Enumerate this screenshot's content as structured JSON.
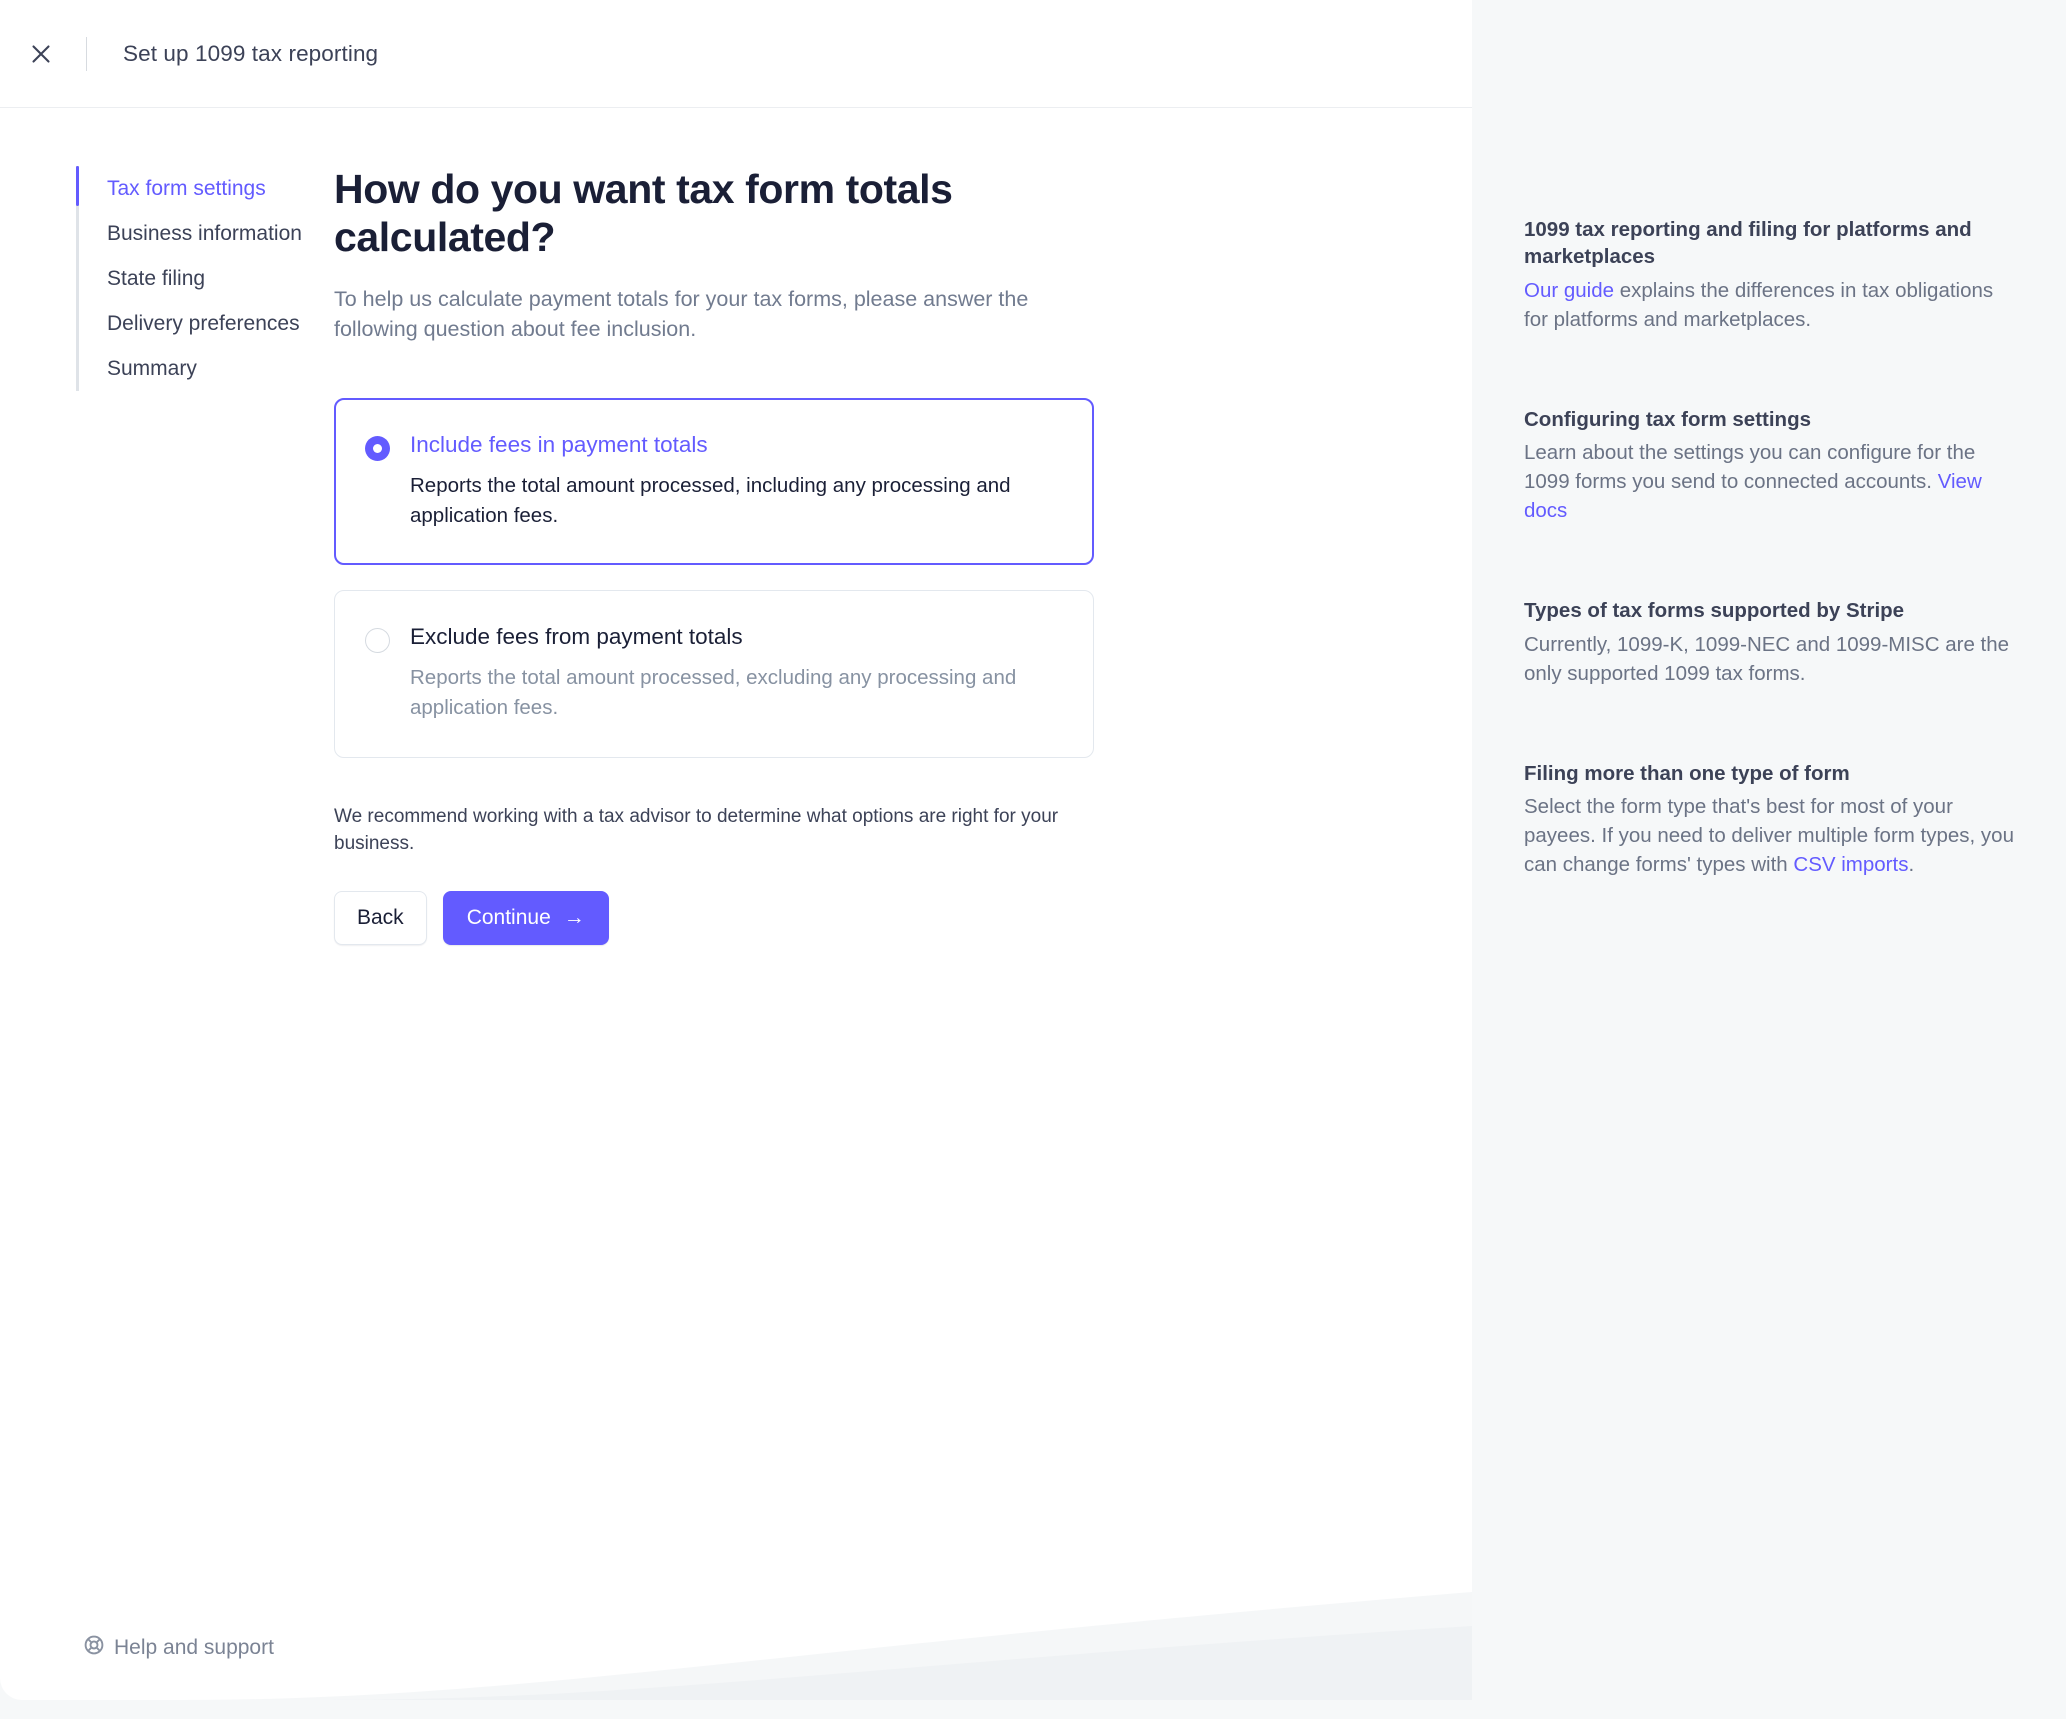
{
  "header": {
    "close_icon": "close-icon",
    "title": "Set up 1099 tax reporting"
  },
  "sidebar": {
    "steps": [
      {
        "label": "Tax form settings",
        "active": true
      },
      {
        "label": "Business information",
        "active": false
      },
      {
        "label": "State filing",
        "active": false
      },
      {
        "label": "Delivery preferences",
        "active": false
      },
      {
        "label": "Summary",
        "active": false
      }
    ]
  },
  "main": {
    "title": "How do you want tax form totals calculated?",
    "subtitle": "To help us calculate payment totals for your tax forms, please answer the following question about fee inclusion.",
    "options": [
      {
        "label": "Include fees in payment totals",
        "description": "Reports the total amount processed, including any processing and application fees.",
        "selected": true
      },
      {
        "label": "Exclude fees from payment totals",
        "description": "Reports the total amount processed, excluding any processing and application fees.",
        "selected": false
      }
    ],
    "note": "We recommend working with a tax advisor to determine what options are right for your business.",
    "back_label": "Back",
    "continue_label": "Continue",
    "continue_arrow": "→"
  },
  "footer": {
    "help_icon": "life-ring-icon",
    "help_label": "Help and support"
  },
  "help_rail": {
    "sections": [
      {
        "heading": "1099 tax reporting and filing for platforms and marketplaces",
        "link_before": "Our guide",
        "text_after": " explains the differences in tax obligations for platforms and marketplaces."
      },
      {
        "heading": "Configuring tax form settings",
        "text_before": "Learn about the settings you can configure for the 1099 forms you send to connected accounts. ",
        "link": "View docs"
      },
      {
        "heading": "Types of tax forms supported by Stripe",
        "text": "Currently, 1099-K, 1099-NEC and 1099-MISC are the only supported 1099 tax forms."
      },
      {
        "heading": "Filing more than one type of form",
        "text_before": "Select the form type that's best for most of your payees. If you need to deliver multiple form types, you can change forms' types with ",
        "link": "CSV imports",
        "text_after": "."
      }
    ]
  },
  "colors": {
    "brand_indigo": "#635bff",
    "text_dark": "#1a1f36",
    "text_muted": "#8792a2",
    "panel_bg": "#ffffff",
    "rail_bg": "#f6f8f9"
  }
}
